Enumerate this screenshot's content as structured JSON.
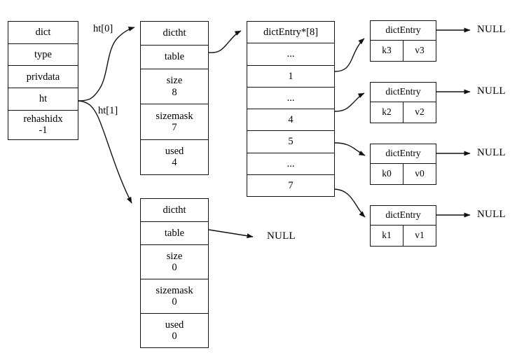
{
  "diagram": {
    "title": "redis dict / dictht / dictEntry structure",
    "stroke_color": "#111111",
    "background_color": "#ffffff"
  },
  "dict_struct": {
    "name": "dict",
    "fields": [
      {
        "label": "dict",
        "value": ""
      },
      {
        "label": "type",
        "value": ""
      },
      {
        "label": "privdata",
        "value": ""
      },
      {
        "label": "ht",
        "value": ""
      },
      {
        "label": "rehashidx",
        "value": "-1"
      }
    ]
  },
  "pointer_labels": {
    "ht0": "ht[0]",
    "ht1": "ht[1]"
  },
  "dictht0": {
    "fields": [
      {
        "label": "dictht",
        "value": ""
      },
      {
        "label": "table",
        "value": ""
      },
      {
        "label": "size",
        "value": "8"
      },
      {
        "label": "sizemask",
        "value": "7"
      },
      {
        "label": "used",
        "value": "4"
      }
    ]
  },
  "dictht1": {
    "fields": [
      {
        "label": "dictht",
        "value": ""
      },
      {
        "label": "table",
        "value": ""
      },
      {
        "label": "size",
        "value": "0"
      },
      {
        "label": "sizemask",
        "value": "0"
      },
      {
        "label": "used",
        "value": "0"
      }
    ]
  },
  "bucket_array": {
    "header": "dictEntry*[8]",
    "slots": [
      {
        "label": "..."
      },
      {
        "label": "1"
      },
      {
        "label": "..."
      },
      {
        "label": "4"
      },
      {
        "label": "5"
      },
      {
        "label": "..."
      },
      {
        "label": "7"
      }
    ]
  },
  "entries": [
    {
      "header": "dictEntry",
      "key": "k3",
      "value": "v3",
      "next": "NULL"
    },
    {
      "header": "dictEntry",
      "key": "k2",
      "value": "v2",
      "next": "NULL"
    },
    {
      "header": "dictEntry",
      "key": "k0",
      "value": "v0",
      "next": "NULL"
    },
    {
      "header": "dictEntry",
      "key": "k1",
      "value": "v1",
      "next": "NULL"
    }
  ],
  "null_labels": {
    "table1_null": "NULL"
  }
}
